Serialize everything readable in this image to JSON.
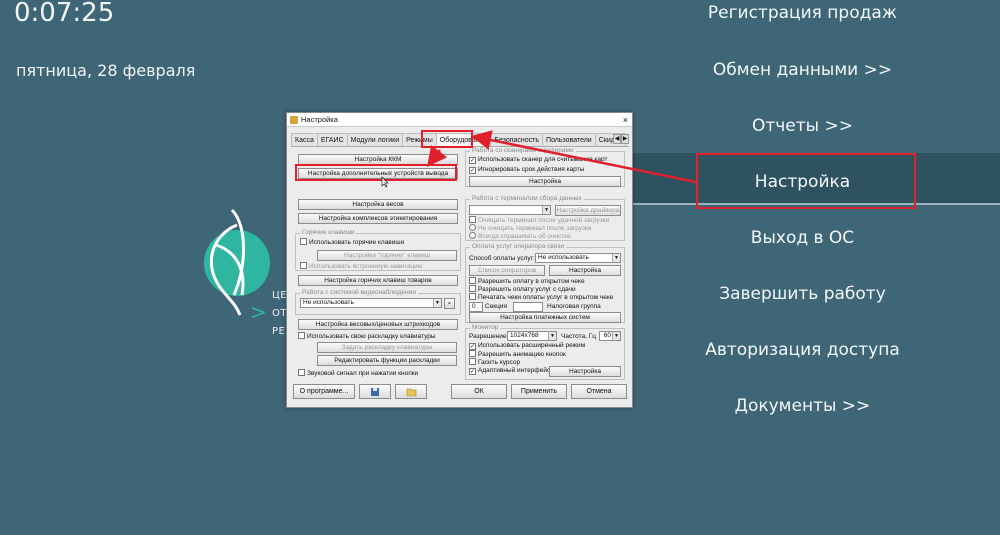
{
  "clock": "0:07:25",
  "date": "пятница, 28 февраля",
  "menu": [
    "Регистрация продаж",
    "Обмен данными >>",
    "Отчеты >>",
    "Настройка",
    "Выход в ОС",
    "Завершить работу",
    "Авторизация доступа",
    "Документы >>"
  ],
  "logo_text": [
    "ЦЕН",
    "ОТР",
    "РЕЦ"
  ],
  "logo_arrow": ">",
  "colors": {
    "background": "#3f6677",
    "menu_band": "#2f5261",
    "highlight": "#e0202c",
    "logo": "#2fb6a0"
  },
  "dialog": {
    "title": "Настройка",
    "close": "×",
    "tabs": [
      "Касса",
      "ЕГАИС",
      "Модули логики",
      "Режимы",
      "Оборудование",
      "Безопасность",
      "Пользователи",
      "Скидки"
    ],
    "tab_prev": "◀",
    "tab_next": "▶",
    "left": {
      "btn_kkm": "Настройка ККМ",
      "btn_extra_devices": "Настройка дополнительных устройств вывода",
      "btn_scales": "Настройка весов",
      "btn_label_sets": "Настройка комплексов этикетирования",
      "hotkeys_group": "Горячие клавиши",
      "hotkeys_use": "Использовать горячие клавиши",
      "hotkeys_btn": "Настройка \"горячих\" клавиш",
      "hotkeys_builtin_nav": "Использовать встроенную навигацию",
      "btn_goods_hotkeys": "Настройка горячих клавиш товаров",
      "video_group": "Работа с системой видеонаблюдения",
      "video_select": "Не использовать",
      "btn_barcodes": "Настройка весовых/ценовых штрихкодов",
      "own_layout": "Использовать свою раскладку клавиатуры",
      "btn_set_layout": "Задать раскладку клавиатуры",
      "btn_edit_layout": "Редактировать функции раскладки",
      "sound_signal": "Звуковой сигнал при нажатии кнопки"
    },
    "right": {
      "scanner_group": "Работа со сканерами и ридерами",
      "use_scanner": "Использовать сканер для считывания карт",
      "ignore_expiry": "Игнорировать срок действия карты",
      "btn_scanner_setup": "Настройка",
      "terminal_group": "Работа с терминалом сбора данных",
      "btn_driver_setup": "Настройка драйвера",
      "terminal_clear_after": "Очищать терминал после удачной загрузки",
      "terminal_no_clear": "Не очищать терминал после загрузки",
      "terminal_ask": "Всегда спрашивать об очистке",
      "operator_group": "Оплата услуг оператора связи",
      "payment_method_label": "Способ оплаты услуг:",
      "payment_method_value": "Не использовать",
      "btn_operators_list": "Список операторов",
      "btn_operators_setup": "Настройка",
      "allow_open_check": "Разрешить оплату в открытом чеке",
      "allow_change": "Разрешить оплату услуг с сдачи",
      "print_checks": "Печатать чеки оплаты услуг в открытом чеке",
      "section_label": "Секция",
      "section_value": "0",
      "tax_group_label": "Налоговая группа",
      "btn_payment_systems": "Настройка платежных систем",
      "monitor_group": "Монитор",
      "resolution_label": "Разрешение",
      "resolution_value": "1024x768",
      "frequency_label": "Частота, Гц",
      "frequency_value": "60",
      "extended_mode": "Использовать расширенный режим",
      "button_animation": "Разрешить анимацию кнопок",
      "hide_cursor": "Гасить курсор",
      "adaptive_ui": "Адаптивный интерфейс",
      "btn_monitor_setup": "Настройка"
    },
    "bottom": {
      "about": "О программе...",
      "ok": "ОК",
      "apply": "Применить",
      "cancel": "Отмена"
    },
    "check_mark": "✓"
  }
}
